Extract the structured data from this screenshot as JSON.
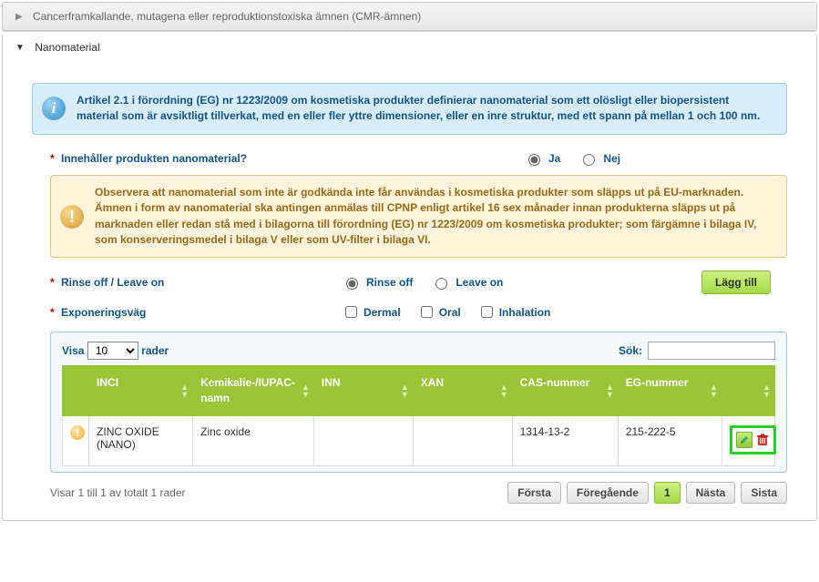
{
  "collapsed_panel": {
    "title": "Cancerframkallande, mutagena eller reproduktionstoxiska ämnen (CMR-ämnen)"
  },
  "nano_panel": {
    "title": "Nanomaterial",
    "info": "Artikel 2.1 i förordning (EG) nr 1223/2009 om kosmetiska produkter definierar nanomaterial som ett olösligt eller biopersistent material som är avsiktligt tillverkat, med en eller fler yttre dimensioner, eller en inre struktur, med ett spann på mellan 1 och 100 nm.",
    "q_contains": "Innehåller produkten nanomaterial?",
    "yes": "Ja",
    "no": "Nej",
    "warn_p1": "Observera att nanomaterial som inte är godkända inte får användas i kosmetiska produkter som släpps ut på EU-marknaden.",
    "warn_p2": "Ämnen i form av nanomaterial ska antingen anmälas till CPNP enligt artikel 16 sex månader innan produkterna släpps ut på marknaden eller redan stå med i bilagorna till förordning (EG) nr 1223/2009 om kosmetiska produkter; som färgämne i bilaga IV, som konserveringsmedel i bilaga V eller som UV-filter i bilaga VI.",
    "q_rinse": "Rinse off / Leave on",
    "rinse": "Rinse off",
    "leave": "Leave on",
    "add_btn": "Lägg till",
    "q_exposure": "Exponeringsväg",
    "exp1": "Dermal",
    "exp2": "Oral",
    "exp3": "Inhalation"
  },
  "table": {
    "show": "Visa",
    "rows": "rader",
    "search": "Sök:",
    "page_size": "10",
    "headers": {
      "status": "",
      "inci": "INCI",
      "chem": "Kemikalie-/IUPAC-namn",
      "inn": "INN",
      "xan": "XAN",
      "cas": "CAS-nummer",
      "eg": "EG-nummer",
      "actions": ""
    },
    "items": [
      {
        "inci": "ZINC OXIDE (NANO)",
        "chem": "Zinc oxide",
        "inn": "",
        "xan": "",
        "cas": "1314-13-2",
        "eg": "215-222-5"
      }
    ],
    "info_text": "Visar 1 till 1 av totalt 1 rader",
    "pager": {
      "first": "Första",
      "prev": "Föregående",
      "page": "1",
      "next": "Nästa",
      "last": "Sista"
    }
  }
}
